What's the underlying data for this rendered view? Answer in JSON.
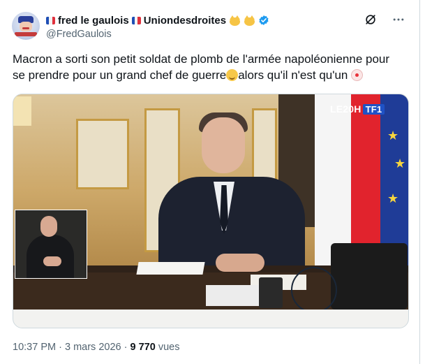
{
  "tweet": {
    "display_name": "fred le gaulois",
    "display_name_suffix": "Uniondesdroites",
    "handle": "@FredGaulois",
    "text_line1": "Macron a sorti son petit soldat de plomb de l'armée napoléonienne pour",
    "text_line2_a": "se prendre pour un grand chef de guerre",
    "text_line2_b": "alors qu'il n'est qu'un",
    "time": "10:37 PM",
    "separator": "·",
    "date": "3 mars 2026",
    "views_count": "9 770",
    "views_label": "vues"
  },
  "media": {
    "channel_logo_left": "LE20H",
    "channel_logo_right": "TF1"
  },
  "icons": {
    "grok": "slashed-circle-icon",
    "more": "ellipsis-icon",
    "verified": "verified-badge-icon",
    "flags": "france-flag-icon",
    "cats": "cat-face-icon",
    "emoji1": "relieved-face-icon",
    "emoji2": "clown-face-icon"
  },
  "colors": {
    "verified": "#1d9bf0",
    "text_secondary": "#536471",
    "text_primary": "#0f1419"
  }
}
